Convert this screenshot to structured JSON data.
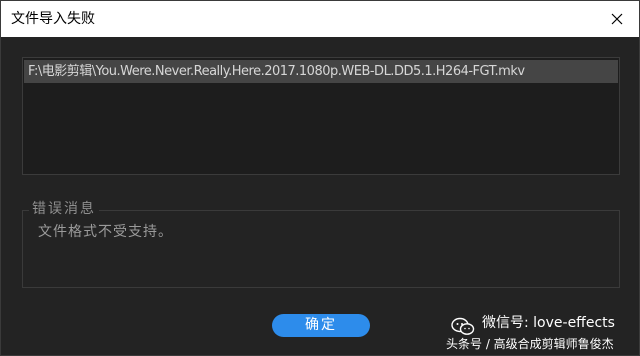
{
  "window": {
    "title": "文件导入失败",
    "close_icon": "close-icon"
  },
  "file_list": {
    "items": [
      "F:\\电影剪辑\\You.Were.Never.Really.Here.2017.1080p.WEB-DL.DD5.1.H264-FGT.mkv"
    ]
  },
  "error_section": {
    "legend": "错误消息",
    "message": "文件格式不受支持。"
  },
  "buttons": {
    "ok_label": "确定"
  },
  "watermark": {
    "icon": "wechat-icon",
    "line1": "微信号: love-effects",
    "line2": "头条号 / 高级合成剪辑师鲁俊杰"
  },
  "colors": {
    "title_bar": "#ffffff",
    "background": "#232323",
    "panel": "#1d1d1d",
    "selected_row": "#454545",
    "accent": "#2d8ceb"
  }
}
